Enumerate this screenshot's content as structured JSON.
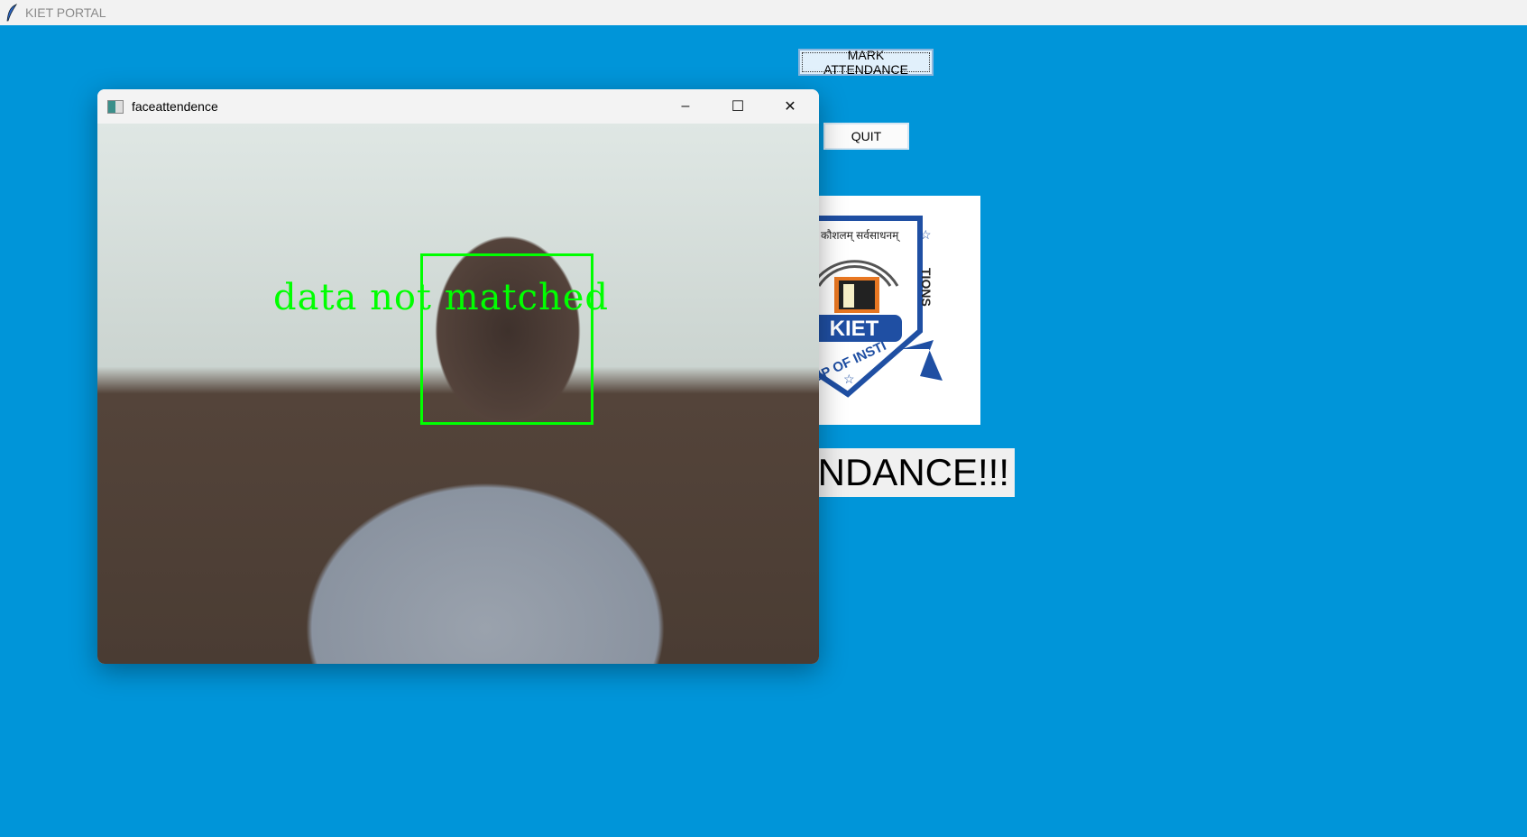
{
  "app": {
    "title": "KIET PORTAL",
    "icon": "feather-icon"
  },
  "buttons": {
    "mark_attendance": "MARK ATTENDANCE",
    "quit": "QUIT"
  },
  "logo": {
    "motto": "कौशलम् सर्वसाधनम्",
    "name": "KIET",
    "subtitle": "GROUP OF INSTITUTIONS"
  },
  "banner": {
    "text": "NDANCE!!!"
  },
  "camera_window": {
    "title": "faceattendence",
    "overlay_text": "data not matched",
    "minimize": "–",
    "maximize": "☐",
    "close": "✕"
  },
  "colors": {
    "background": "#0095d9",
    "detection": "#00ff00",
    "logo_blue": "#1f4fa3"
  }
}
